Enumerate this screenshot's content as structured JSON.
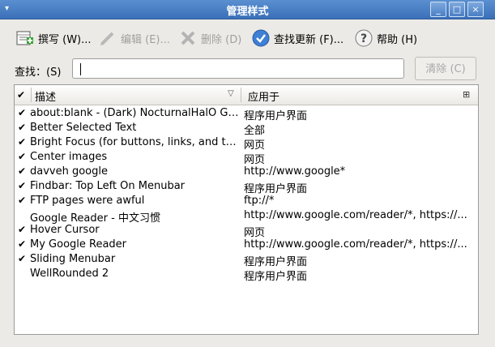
{
  "window": {
    "title": "管理样式",
    "minimize": "_",
    "maximize": "□",
    "close": "×"
  },
  "toolbar": {
    "write": "撰写 (W)...",
    "edit": "编辑 (E)...",
    "delete": "删除 (D)",
    "check_updates": "查找更新 (F)...",
    "help": "帮助 (H)"
  },
  "search": {
    "label": "查找：(S)",
    "value": "",
    "clear": "清除 (C)"
  },
  "table": {
    "columns": {
      "enabled": "✔",
      "description": "描述",
      "applies_to": "应用于"
    },
    "rows": [
      {
        "checked": "✔",
        "description": "about:blank - (Dark) NocturnalHalO Gr...",
        "applies_to": "程序用户界面"
      },
      {
        "checked": "✔",
        "description": "Better Selected Text",
        "applies_to": "全部"
      },
      {
        "checked": "✔",
        "description": "Bright Focus (for buttons, links, and te...",
        "applies_to": "网页"
      },
      {
        "checked": "✔",
        "description": "Center images",
        "applies_to": "网页"
      },
      {
        "checked": "✔",
        "description": "davveh google",
        "applies_to": "http://www.google*"
      },
      {
        "checked": "✔",
        "description": "Findbar: Top Left On Menubar",
        "applies_to": "程序用户界面"
      },
      {
        "checked": "✔",
        "description": "FTP pages were awful",
        "applies_to": "ftp://*"
      },
      {
        "checked": "",
        "description": "Google Reader - 中文习惯",
        "applies_to": "http://www.google.com/reader/*, https://..."
      },
      {
        "checked": "✔",
        "description": "Hover Cursor",
        "applies_to": "网页"
      },
      {
        "checked": "✔",
        "description": "My Google Reader",
        "applies_to": "http://www.google.com/reader/*, https://..."
      },
      {
        "checked": "✔",
        "description": "Sliding Menubar",
        "applies_to": "程序用户界面"
      },
      {
        "checked": "",
        "description": "WellRounded 2",
        "applies_to": "程序用户界面"
      }
    ]
  }
}
